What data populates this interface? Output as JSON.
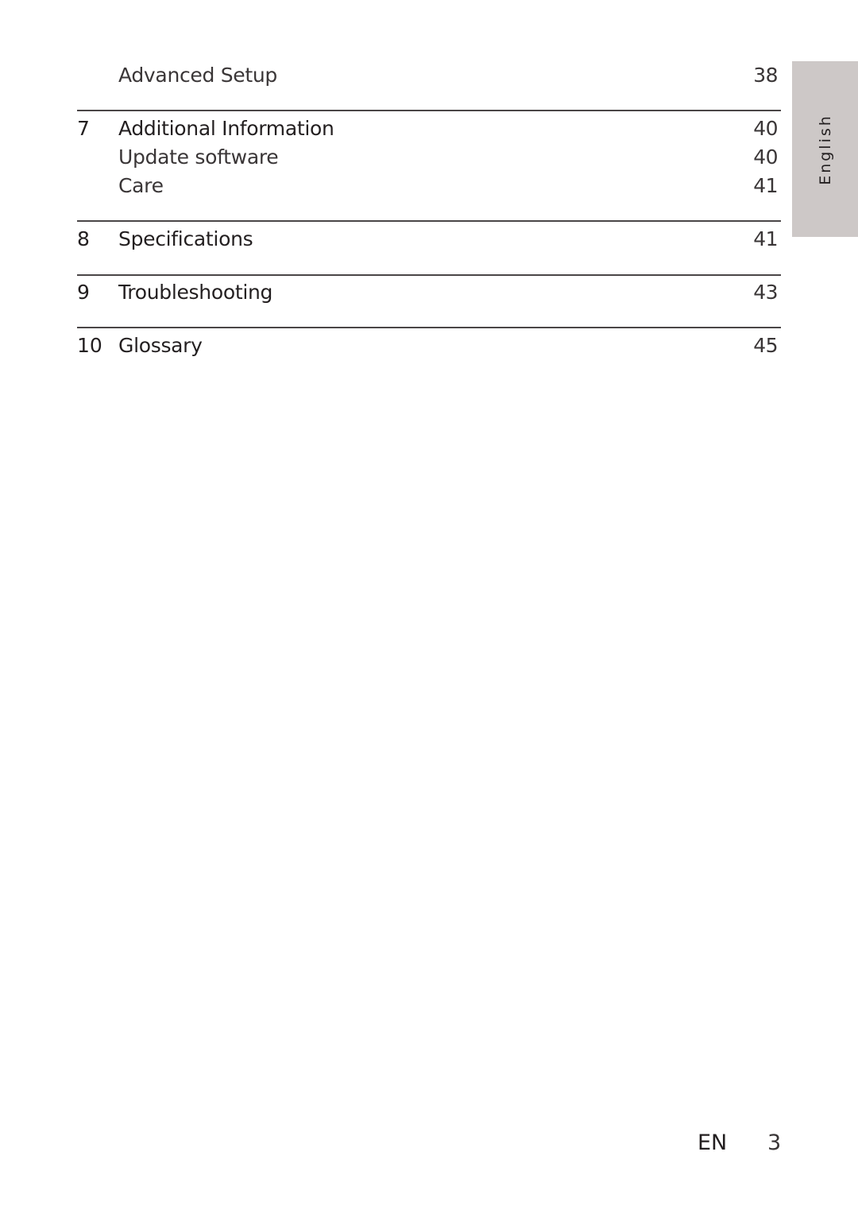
{
  "toc": {
    "entries": [
      {
        "number": "",
        "title": "Advanced Setup",
        "page": "38",
        "level": "sub"
      },
      {
        "number": "7",
        "title": "Additional Information",
        "page": "40",
        "level": "chapter"
      },
      {
        "number": "",
        "title": "Update software",
        "page": "40",
        "level": "sub"
      },
      {
        "number": "",
        "title": "Care",
        "page": "41",
        "level": "sub"
      },
      {
        "number": "8",
        "title": "Specifications",
        "page": "41",
        "level": "chapter"
      },
      {
        "number": "9",
        "title": "Troubleshooting",
        "page": "43",
        "level": "chapter"
      },
      {
        "number": "10",
        "title": "Glossary",
        "page": "45",
        "level": "chapter"
      }
    ]
  },
  "language_tab": {
    "label": "English",
    "color": "#cdc8c7"
  },
  "footer": {
    "language_code": "EN",
    "page_number": "3"
  }
}
